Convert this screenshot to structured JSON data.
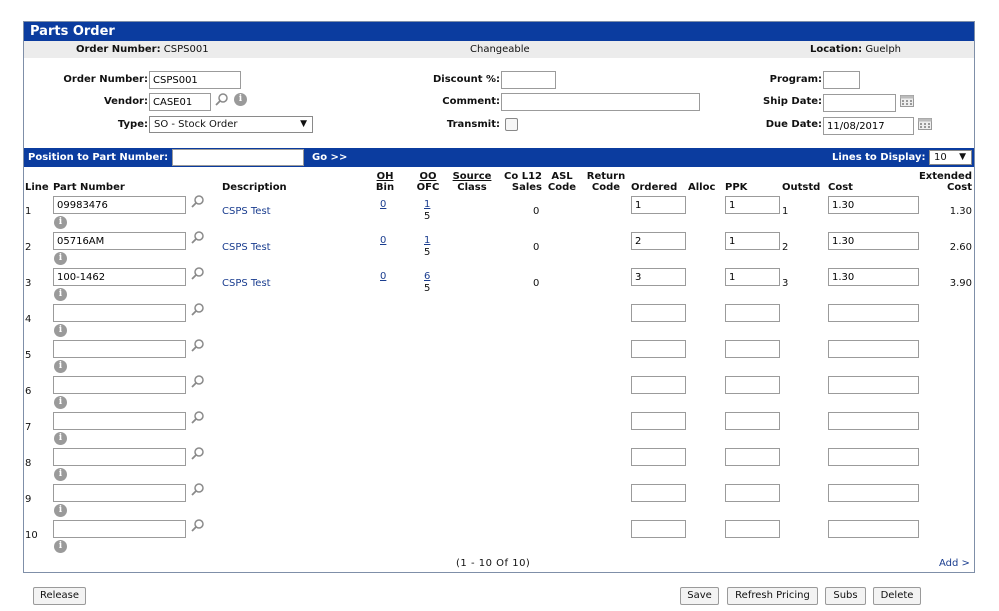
{
  "header": {
    "title": "Parts Order",
    "order_number_label": "Order Number:",
    "order_number_value": "CSPS001",
    "status": "Changeable",
    "location_label": "Location:",
    "location_value": "Guelph"
  },
  "form": {
    "order_number_label": "Order Number:",
    "order_number_value": "CSPS001",
    "vendor_label": "Vendor:",
    "vendor_value": "CASE01",
    "type_label": "Type:",
    "type_value": "SO - Stock Order",
    "discount_label": "Discount %:",
    "discount_value": "",
    "comment_label": "Comment:",
    "comment_value": "",
    "transmit_label": "Transmit:",
    "program_label": "Program:",
    "program_value": "",
    "ship_date_label": "Ship Date:",
    "ship_date_value": "",
    "due_date_label": "Due Date:",
    "due_date_value": "11/08/2017"
  },
  "position_bar": {
    "label": "Position to Part Number:",
    "value": "",
    "go": "Go >>",
    "lines_label": "Lines to Display:",
    "lines_value": "10"
  },
  "columns": {
    "line": "Line",
    "part_number": "Part Number",
    "description": "Description",
    "oh": "OH",
    "bin": "Bin",
    "oo": "OO",
    "ofc": "OFC",
    "source": "Source",
    "class": "Class",
    "col12": "Co L12",
    "sales": "Sales",
    "asl": "ASL",
    "code": "Code",
    "return": "Return",
    "return_code": "Code",
    "ordered": "Ordered",
    "alloc": "Alloc",
    "ppk": "PPK",
    "outstd": "Outstd",
    "cost": "Cost",
    "extended": "Extended",
    "extended_cost": "Cost"
  },
  "rows": [
    {
      "line": "1",
      "part": "09983476",
      "desc": "CSPS Test",
      "oh": "0",
      "oo": "1",
      "ofc": "5",
      "sales": "0",
      "ordered": "1",
      "ppk": "1",
      "outstd": "1",
      "cost": "1.30",
      "ext": "1.30"
    },
    {
      "line": "2",
      "part": "05716AM",
      "desc": "CSPS Test",
      "oh": "0",
      "oo": "1",
      "ofc": "5",
      "sales": "0",
      "ordered": "2",
      "ppk": "1",
      "outstd": "2",
      "cost": "1.30",
      "ext": "2.60"
    },
    {
      "line": "3",
      "part": "100-1462",
      "desc": "CSPS Test",
      "oh": "0",
      "oo": "6",
      "ofc": "5",
      "sales": "0",
      "ordered": "3",
      "ppk": "1",
      "outstd": "3",
      "cost": "1.30",
      "ext": "3.90"
    },
    {
      "line": "4",
      "part": "",
      "desc": "",
      "oh": "",
      "oo": "",
      "ofc": "",
      "sales": "",
      "ordered": "",
      "ppk": "",
      "outstd": "",
      "cost": "",
      "ext": ""
    },
    {
      "line": "5",
      "part": "",
      "desc": "",
      "oh": "",
      "oo": "",
      "ofc": "",
      "sales": "",
      "ordered": "",
      "ppk": "",
      "outstd": "",
      "cost": "",
      "ext": ""
    },
    {
      "line": "6",
      "part": "",
      "desc": "",
      "oh": "",
      "oo": "",
      "ofc": "",
      "sales": "",
      "ordered": "",
      "ppk": "",
      "outstd": "",
      "cost": "",
      "ext": ""
    },
    {
      "line": "7",
      "part": "",
      "desc": "",
      "oh": "",
      "oo": "",
      "ofc": "",
      "sales": "",
      "ordered": "",
      "ppk": "",
      "outstd": "",
      "cost": "",
      "ext": ""
    },
    {
      "line": "8",
      "part": "",
      "desc": "",
      "oh": "",
      "oo": "",
      "ofc": "",
      "sales": "",
      "ordered": "",
      "ppk": "",
      "outstd": "",
      "cost": "",
      "ext": ""
    },
    {
      "line": "9",
      "part": "",
      "desc": "",
      "oh": "",
      "oo": "",
      "ofc": "",
      "sales": "",
      "ordered": "",
      "ppk": "",
      "outstd": "",
      "cost": "",
      "ext": ""
    },
    {
      "line": "10",
      "part": "",
      "desc": "",
      "oh": "",
      "oo": "",
      "ofc": "",
      "sales": "",
      "ordered": "",
      "ppk": "",
      "outstd": "",
      "cost": "",
      "ext": ""
    }
  ],
  "pager": "(1 - 10 Of 10)",
  "add_link": "Add >",
  "buttons": {
    "release": "Release",
    "save": "Save",
    "refresh": "Refresh Pricing",
    "subs": "Subs",
    "delete": "Delete"
  },
  "icons": {
    "search": "magnifier-icon",
    "info": "info-icon",
    "calendar": "calendar-icon"
  },
  "colors": {
    "header_blue": "#0b3c9f",
    "link_blue": "#1a3d8f"
  }
}
